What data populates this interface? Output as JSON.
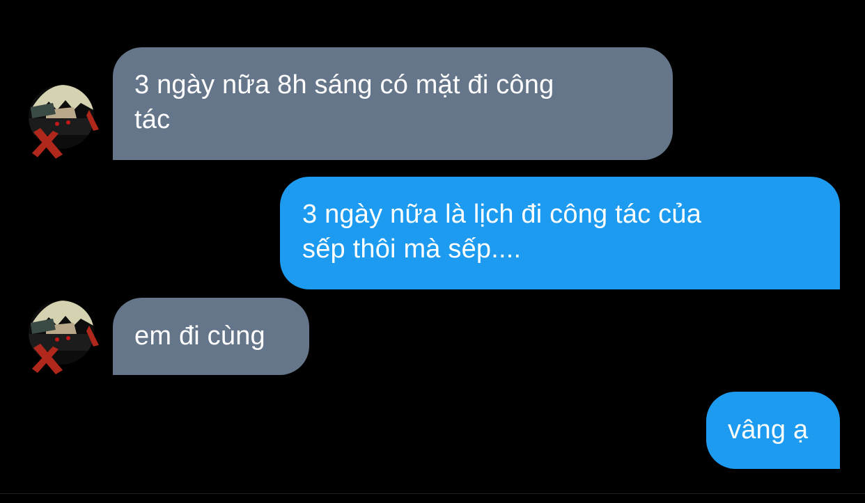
{
  "colors": {
    "background": "#000000",
    "incoming_bubble": "#66768a",
    "outgoing_bubble": "#1d9bf0",
    "text": "#ffffff"
  },
  "messages": [
    {
      "direction": "incoming",
      "avatar_icon": "anime-avatar-icon",
      "lines": [
        "3 ngày nữa 8h sáng có mặt đi công",
        "tác"
      ]
    },
    {
      "direction": "outgoing",
      "lines": [
        "3 ngày nữa là lịch đi công tác của",
        "sếp thôi mà sếp...."
      ]
    },
    {
      "direction": "incoming",
      "avatar_icon": "anime-avatar-icon",
      "lines": [
        "em đi cùng"
      ]
    },
    {
      "direction": "outgoing",
      "lines": [
        "vâng ạ"
      ]
    }
  ]
}
